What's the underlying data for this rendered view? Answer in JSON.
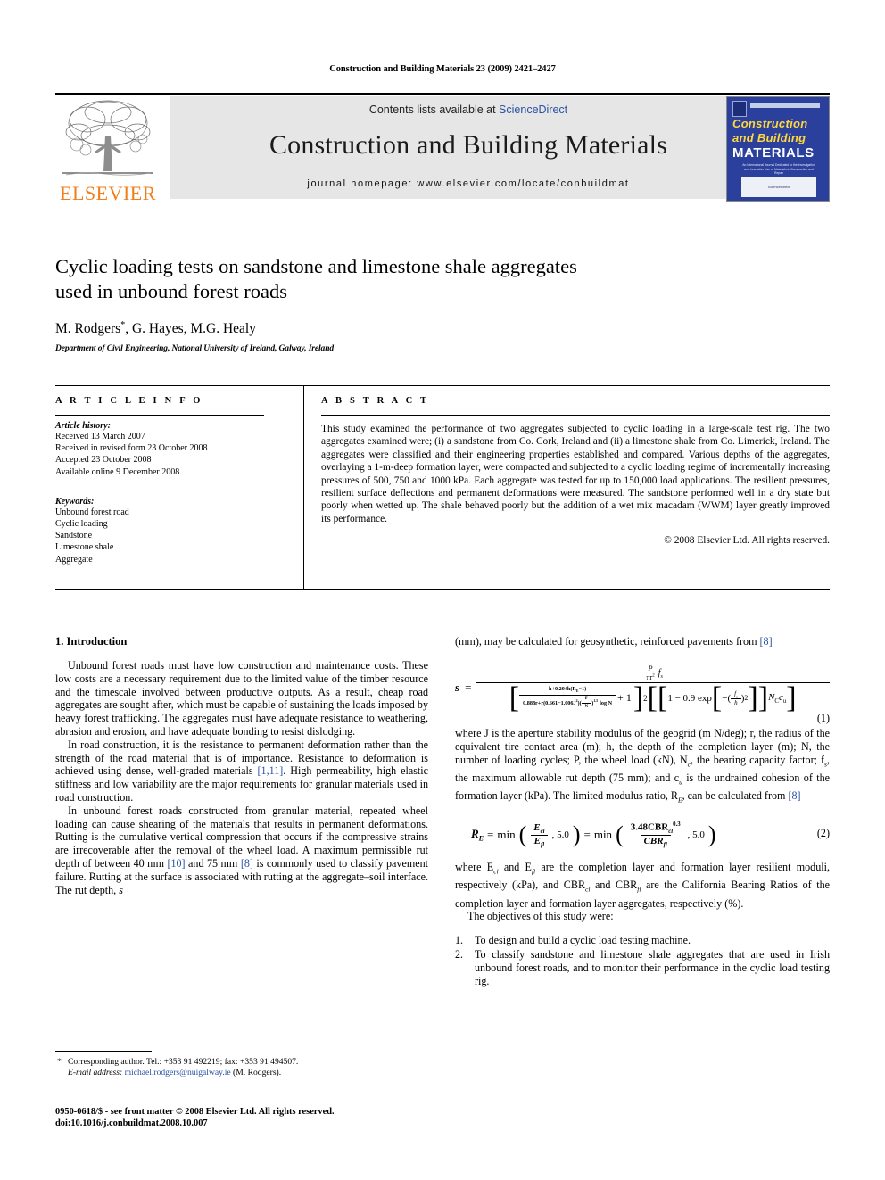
{
  "running_head": "Construction and Building Materials 23 (2009) 2421–2427",
  "masthead": {
    "contents_prefix": "Contents lists available at ",
    "sciencedirect": "ScienceDirect",
    "journal_title": "Construction and Building Materials",
    "homepage": "journal homepage: www.elsevier.com/locate/conbuildmat",
    "publisher": "ELSEVIER",
    "cover": {
      "line1": "Construction",
      "line2": "and Building",
      "line3": "MATERIALS",
      "blurb": "An International Journal Dedicated to the Investigation and Innovative Use of Materials in Construction and Repair",
      "footer": "ScienceDirect"
    },
    "accent_link_color": "#2952a3",
    "elsevier_orange": "#f07f1a",
    "cover_blue": "#2b3f9c",
    "cover_yellow": "#ffd83d"
  },
  "article": {
    "title_line1": "Cyclic loading tests on sandstone and limestone shale aggregates",
    "title_line2": "used in unbound forest roads",
    "authors": "M. Rodgers",
    "authors_rest": ", G. Hayes, M.G. Healy",
    "author_marker": "*",
    "affiliation": "Department of Civil Engineering, National University of Ireland, Galway, Ireland"
  },
  "info": {
    "heading": "A R T I C L E   I N F O",
    "history_label": "Article history:",
    "history": [
      "Received 13 March 2007",
      "Received in revised form 23 October 2008",
      "Accepted 23 October 2008",
      "Available online 9 December 2008"
    ],
    "keywords_label": "Keywords:",
    "keywords": [
      "Unbound forest road",
      "Cyclic loading",
      "Sandstone",
      "Limestone shale",
      "Aggregate"
    ]
  },
  "abstract": {
    "heading": "A B S T R A C T",
    "text": "This study examined the performance of two aggregates subjected to cyclic loading in a large-scale test rig. The two aggregates examined were; (i) a sandstone from Co. Cork, Ireland and (ii) a limestone shale from Co. Limerick, Ireland. The aggregates were classified and their engineering properties established and compared. Various depths of the aggregates, overlaying a 1-m-deep formation layer, were compacted and subjected to a cyclic loading regime of incrementally increasing pressures of 500, 750 and 1000 kPa. Each aggregate was tested for up to 150,000 load applications. The resilient pressures, resilient surface deflections and permanent deformations were measured. The sandstone performed well in a dry state but poorly when wetted up. The shale behaved poorly but the addition of a wet mix macadam (WWM) layer greatly improved its performance.",
    "copyright": "© 2008 Elsevier Ltd. All rights reserved."
  },
  "body": {
    "section1_heading": "1. Introduction",
    "para1_a": "Unbound forest roads must have low construction and maintenance costs. These low costs are a necessary requirement due to the limited value of the timber resource and the timescale involved between productive outputs. As a result, cheap road aggregates are sought after, which must be capable of sustaining the loads imposed by heavy forest trafficking. The aggregates must have adequate resistance to weathering, abrasion and erosion, and have adequate bonding to resist dislodging.",
    "para2_a": "In road construction, it is the resistance to permanent deformation rather than the strength of the road material that is of importance. Resistance to deformation is achieved using dense, well-graded materials ",
    "para2_ref": "[1,11]",
    "para2_b": ". High permeability, high elastic stiffness and low variability are the major requirements for granular materials used in road construction.",
    "para3_a": "In unbound forest roads constructed from granular material, repeated wheel loading can cause shearing of the materials that results in permanent deformations. Rutting is the cumulative vertical compression that occurs if the compressive strains are irrecoverable after the removal of the wheel load. A maximum permissible rut depth of between 40 mm ",
    "para3_ref1": "[10]",
    "para3_b": " and 75 mm ",
    "para3_ref2": "[8]",
    "para3_c": " is commonly used to classify pavement failure. Rutting at the surface is associated with rutting at the aggregate–soil interface. The rut depth, ",
    "para3_italic": "s",
    "para4_a": "(mm), may be calculated for geosynthetic, reinforced pavements from ",
    "para4_ref": "[8]",
    "para5_a": "where J is the aperture stability modulus of the geogrid (m N/deg); r, the radius of the equivalent tire contact area (m); h, the depth of the completion layer (m); N, the number of loading cycles; P, the wheel load (kN), N",
    "para5_b": ", the bearing capacity factor; f",
    "para5_c": ", the maximum allowable rut depth (75 mm); and c",
    "para5_d": " is the undrained cohesion of the formation layer (kPa). The limited modulus ratio, R",
    "para5_e": ", can be calculated from ",
    "para5_ref": "[8]",
    "para6_a": "where E",
    "para6_b": " and E",
    "para6_c": " are the completion layer and formation layer resilient moduli, respectively (kPa), and CBR",
    "para6_d": " and CBR",
    "para6_e": " are the California Bearing Ratios of the completion layer and formation layer aggregates, respectively (%).",
    "para7": "The objectives of this study were:",
    "objectives": [
      {
        "marker": "1.",
        "text": "To design and build a cyclic load testing machine."
      },
      {
        "marker": "2.",
        "text": "To classify sandstone and limestone shale aggregates that are used in Irish unbound forest roads, and to monitor their performance in the cyclic load testing rig."
      }
    ]
  },
  "equations": {
    "eq1_number": "(1)",
    "eq1_lhs": "s",
    "eq1_numerator_frac_num": "P",
    "eq1_numerator_frac_den": "πr",
    "eq1_numerator_frac_den_exp": "2",
    "eq1_numerator_tail": "f",
    "eq1_numerator_tail_sub": "s",
    "eq1_den_frac_num": "h+0.204h(R",
    "eq1_den_frac_num_sub": "E",
    "eq1_den_frac_num_tail": "−1)",
    "eq1_den_frac_den": "0.888r+r(0.661−1.006J",
    "eq1_den_frac_den_exp": "2",
    "eq1_den_frac_den_mid": ")(",
    "eq1_den_frac_den_ratio_num": "P",
    "eq1_den_frac_den_ratio_den": "N",
    "eq1_den_frac_den_ratio_close": ")",
    "eq1_den_frac_den_ratio_exp": "1.5",
    "eq1_den_frac_den_tail": "log N",
    "eq1_den_plus_one": "+ 1",
    "eq1_den_exp": "2",
    "eq1_bracket_body_a": "1 − 0.9 exp",
    "eq1_bracket_body_neg": "−(",
    "eq1_bracket_ratio_num": "f",
    "eq1_bracket_ratio_num_sub": "s",
    "eq1_bracket_ratio_den": "h",
    "eq1_bracket_body_close": ")",
    "eq1_bracket_body_exp": "2",
    "eq1_tail": "N",
    "eq1_tail_sub": "C",
    "eq1_tail2": "c",
    "eq1_tail2_sub": "u",
    "eq2_number": "(2)",
    "eq2_lhs": "R",
    "eq2_lhs_sub": "E",
    "eq2_eq": "=",
    "eq2_min": "min",
    "eq2_f1_num": "E",
    "eq2_f1_num_sub": "cl",
    "eq2_f1_den": "E",
    "eq2_f1_den_sub": "fl",
    "eq2_val": ", 5.0",
    "eq2_f2_num": "3.48CBR",
    "eq2_f2_num_sub": "cl",
    "eq2_f2_num_exp": "0.3",
    "eq2_f2_den": "CBR",
    "eq2_f2_den_sub": "fl",
    "sub_c": "c",
    "sub_s": "s",
    "sub_u": "u",
    "sub_E": "E",
    "sub_cl": "cl",
    "sub_fl": "fl"
  },
  "footnote": {
    "star": "*",
    "corresponding": "Corresponding author. Tel.: +353 91 492219; fax: +353 91 494507.",
    "email_label": "E-mail address:",
    "email": "michael.rodgers@nuigalway.ie",
    "email_suffix": " (M. Rodgers).",
    "imprint_line1": "0950-0618/$ - see front matter © 2008 Elsevier Ltd. All rights reserved.",
    "imprint_line2": "doi:10.1016/j.conbuildmat.2008.10.007"
  }
}
